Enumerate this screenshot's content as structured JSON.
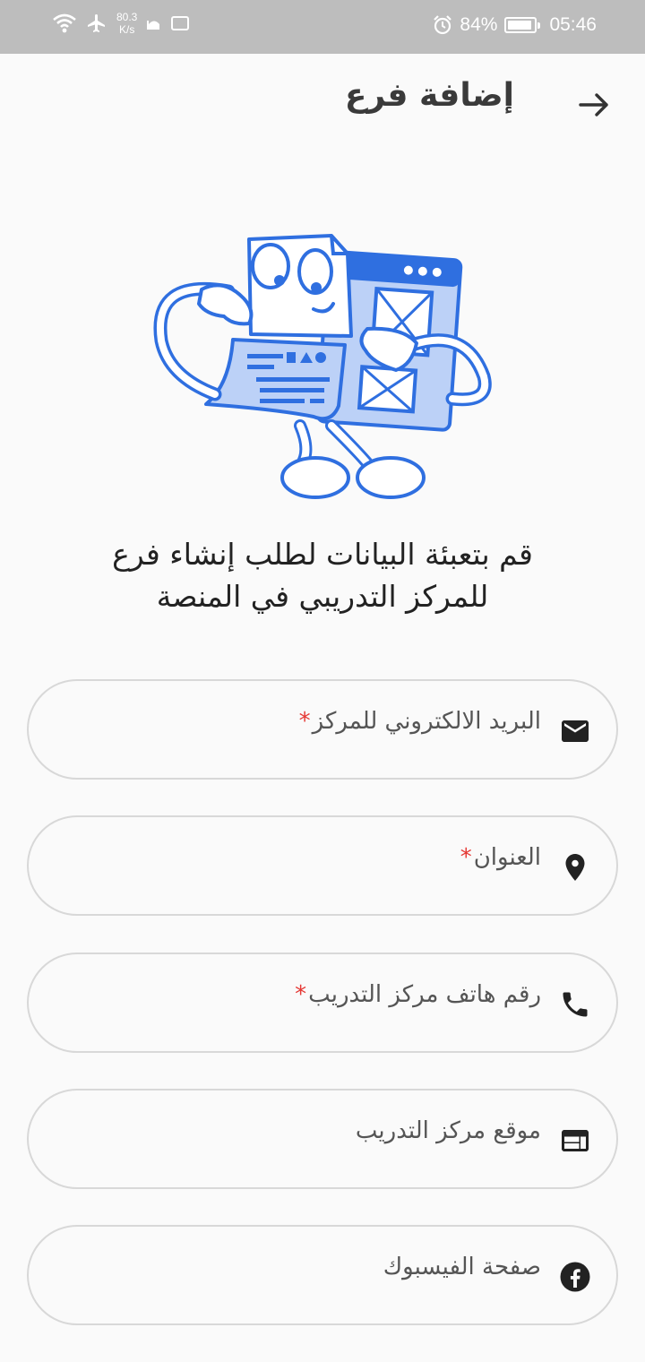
{
  "status_bar": {
    "net_speed_value": "80.3",
    "net_speed_unit": "K/s",
    "battery": "84%",
    "time": "05:46",
    "battery_level": 0.84
  },
  "header": {
    "title": "إضافة فرع",
    "back_icon": "arrow-right-icon"
  },
  "illustration": {
    "name": "document-character-illustration"
  },
  "intro": {
    "line1": "قم بتعبئة البيانات لطلب إنشاء فرع",
    "line2": "للمركز التدريبي في المنصة"
  },
  "form": {
    "fields": [
      {
        "placeholder": "البريد الالكتروني للمركز",
        "required_mark": "*",
        "icon": "email-icon"
      },
      {
        "placeholder": "العنوان",
        "required_mark": "*",
        "icon": "location-pin-icon"
      },
      {
        "placeholder": "رقم هاتف مركز التدريب",
        "required_mark": "*",
        "icon": "phone-icon"
      },
      {
        "placeholder": "موقع مركز التدريب",
        "icon": "web-icon"
      },
      {
        "placeholder": "صفحة الفيسبوك",
        "icon": "facebook-icon"
      }
    ]
  },
  "colors": {
    "accent_blue": "#2f6fe0",
    "required": "#e53935",
    "status_bar": "#bdbdbd"
  }
}
